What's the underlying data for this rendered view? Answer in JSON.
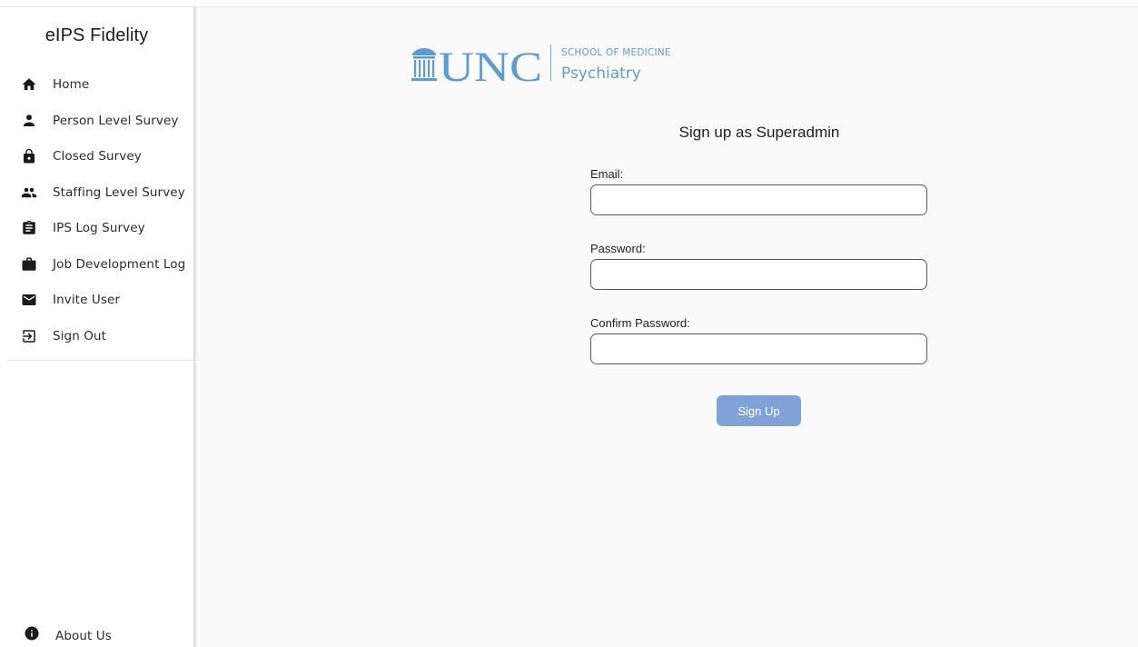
{
  "app": {
    "title": "eIPS Fidelity"
  },
  "sidebar": {
    "items": [
      {
        "label": "Home",
        "icon": "home-icon"
      },
      {
        "label": "Person Level Survey",
        "icon": "person-icon"
      },
      {
        "label": "Closed Survey",
        "icon": "lock-icon"
      },
      {
        "label": "Staffing Level Survey",
        "icon": "people-icon"
      },
      {
        "label": "IPS Log Survey",
        "icon": "clipboard-icon"
      },
      {
        "label": "Job Development Log",
        "icon": "briefcase-icon"
      },
      {
        "label": "Invite User",
        "icon": "mail-icon"
      },
      {
        "label": "Sign Out",
        "icon": "logout-icon"
      }
    ],
    "footer": {
      "label": "About Us",
      "icon": "info-icon"
    }
  },
  "logo": {
    "wordmark": "UNC",
    "line1": "SCHOOL OF MEDICINE",
    "line2": "Psychiatry",
    "color": "#5e9bd2"
  },
  "form": {
    "title": "Sign up as Superadmin",
    "email_label": "Email:",
    "email_value": "",
    "password_label": "Password:",
    "password_value": "",
    "confirm_label": "Confirm Password:",
    "confirm_value": "",
    "submit_label": "Sign Up",
    "submit_color": "#7fa3d6"
  }
}
